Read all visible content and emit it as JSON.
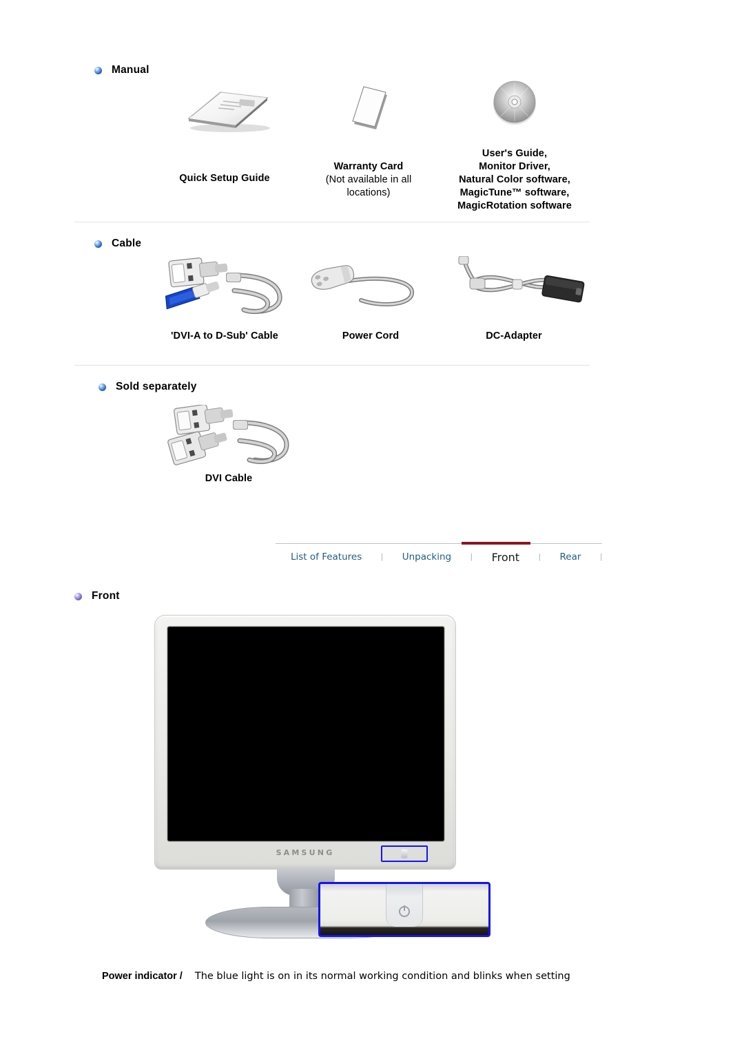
{
  "sections": [
    {
      "id": "manual",
      "bullet": "bullet-icon",
      "label": "Manual",
      "items": [
        {
          "name": "quick-setup-guide",
          "icon": "booklet-icon",
          "caption_main": "Quick Setup Guide",
          "caption_sub": ""
        },
        {
          "name": "warranty-card",
          "icon": "card-icon",
          "caption_main": "Warranty Card",
          "caption_sub": "(Not available in all locations)"
        },
        {
          "name": "software-cd",
          "icon": "cd-icon",
          "caption_main": "User's Guide,\nMonitor Driver,\nNatural Color software,\nMagicTune™ software,\nMagicRotation software",
          "caption_sub": ""
        }
      ]
    },
    {
      "id": "cable",
      "bullet": "bullet-icon",
      "label": "Cable",
      "items": [
        {
          "name": "dvi-a-to-dsub-cable",
          "icon": "dvi-dsub-cable-icon",
          "caption_main": "'DVI-A to D-Sub' Cable",
          "caption_sub": ""
        },
        {
          "name": "power-cord",
          "icon": "power-cord-icon",
          "caption_main": "Power Cord",
          "caption_sub": ""
        },
        {
          "name": "dc-adapter",
          "icon": "dc-adapter-icon",
          "caption_main": "DC-Adapter",
          "caption_sub": ""
        }
      ]
    },
    {
      "id": "sold-separately",
      "bullet": "bullet-icon",
      "label": "Sold separately",
      "items": [
        {
          "name": "dvi-cable",
          "icon": "dvi-cable-icon",
          "caption_main": "DVI Cable",
          "caption_sub": ""
        }
      ]
    }
  ],
  "manual_captions": {
    "quick_setup": "Quick Setup Guide",
    "warranty_title": "Warranty Card",
    "warranty_note_line1": "(Not available in all",
    "warranty_note_line2": "locations)",
    "software_line1": "User's Guide,",
    "software_line2": "Monitor Driver,",
    "software_line3": "Natural Color software,",
    "software_line4": "MagicTune™ software,",
    "software_line5": "MagicRotation software"
  },
  "cable_captions": {
    "dvi_dsub": "'DVI-A to D-Sub' Cable",
    "power_cord": "Power Cord",
    "dc_adapter": "DC-Adapter"
  },
  "sold_separately_captions": {
    "dvi_cable": "DVI Cable"
  },
  "nav": {
    "tabs": [
      {
        "label": "List of Features",
        "active": false
      },
      {
        "label": "Unpacking",
        "active": false
      },
      {
        "label": "Front",
        "active": true
      },
      {
        "label": "Rear",
        "active": false
      }
    ],
    "separator": "|",
    "active_color": "#8c1423",
    "link_color": "#1f5d84"
  },
  "front_section": {
    "bullet": "bullet-icon-purple",
    "label": "Front",
    "monitor_brand": "SAMSUNG",
    "highlight_color": "#1414f0"
  },
  "power_indicator": {
    "term": "Power indicator /",
    "description": "The blue light is on in its normal working condition and blinks when setting"
  }
}
